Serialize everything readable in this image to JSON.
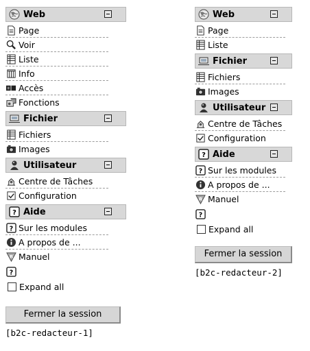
{
  "menus": [
    {
      "sections": [
        {
          "title": "Web",
          "icon": "globe-icon",
          "items": [
            {
              "label": "Page",
              "icon": "page-icon"
            },
            {
              "label": "Voir",
              "icon": "view-icon"
            },
            {
              "label": "Liste",
              "icon": "list-icon"
            },
            {
              "label": "Info",
              "icon": "info-icon"
            },
            {
              "label": "Accès",
              "icon": "access-icon"
            },
            {
              "label": "Fonctions",
              "icon": "functions-icon"
            }
          ]
        },
        {
          "title": "Fichier",
          "icon": "folder-icon",
          "items": [
            {
              "label": "Fichiers",
              "icon": "list-icon"
            },
            {
              "label": "Images",
              "icon": "camera-icon"
            }
          ]
        },
        {
          "title": "Utilisateur",
          "icon": "user-icon",
          "items": [
            {
              "label": "Centre de Tâches",
              "icon": "task-icon"
            },
            {
              "label": "Configuration",
              "icon": "config-icon"
            }
          ]
        },
        {
          "title": "Aide",
          "icon": "help-icon",
          "items": [
            {
              "label": "Sur les modules",
              "icon": "help-icon"
            },
            {
              "label": "A propos de ...",
              "icon": "about-icon"
            },
            {
              "label": "Manuel",
              "icon": "manual-icon"
            }
          ]
        }
      ],
      "expand_all": "Expand all",
      "logout": "Fermer la session",
      "user": "[b2c-redacteur-1]"
    },
    {
      "sections": [
        {
          "title": "Web",
          "icon": "globe-icon",
          "items": [
            {
              "label": "Page",
              "icon": "page-icon"
            },
            {
              "label": "Liste",
              "icon": "list-icon"
            }
          ]
        },
        {
          "title": "Fichier",
          "icon": "folder-icon",
          "items": [
            {
              "label": "Fichiers",
              "icon": "list-icon"
            },
            {
              "label": "Images",
              "icon": "camera-icon"
            }
          ]
        },
        {
          "title": "Utilisateur",
          "icon": "user-icon",
          "items": [
            {
              "label": "Centre de Tâches",
              "icon": "task-icon"
            },
            {
              "label": "Configuration",
              "icon": "config-icon"
            }
          ]
        },
        {
          "title": "Aide",
          "icon": "help-icon",
          "items": [
            {
              "label": "Sur les modules",
              "icon": "help-icon"
            },
            {
              "label": "A propos de ...",
              "icon": "about-icon"
            },
            {
              "label": "Manuel",
              "icon": "manual-icon"
            }
          ]
        }
      ],
      "expand_all": "Expand all",
      "logout": "Fermer la session",
      "user": "[b2c-redacteur-2]"
    }
  ]
}
